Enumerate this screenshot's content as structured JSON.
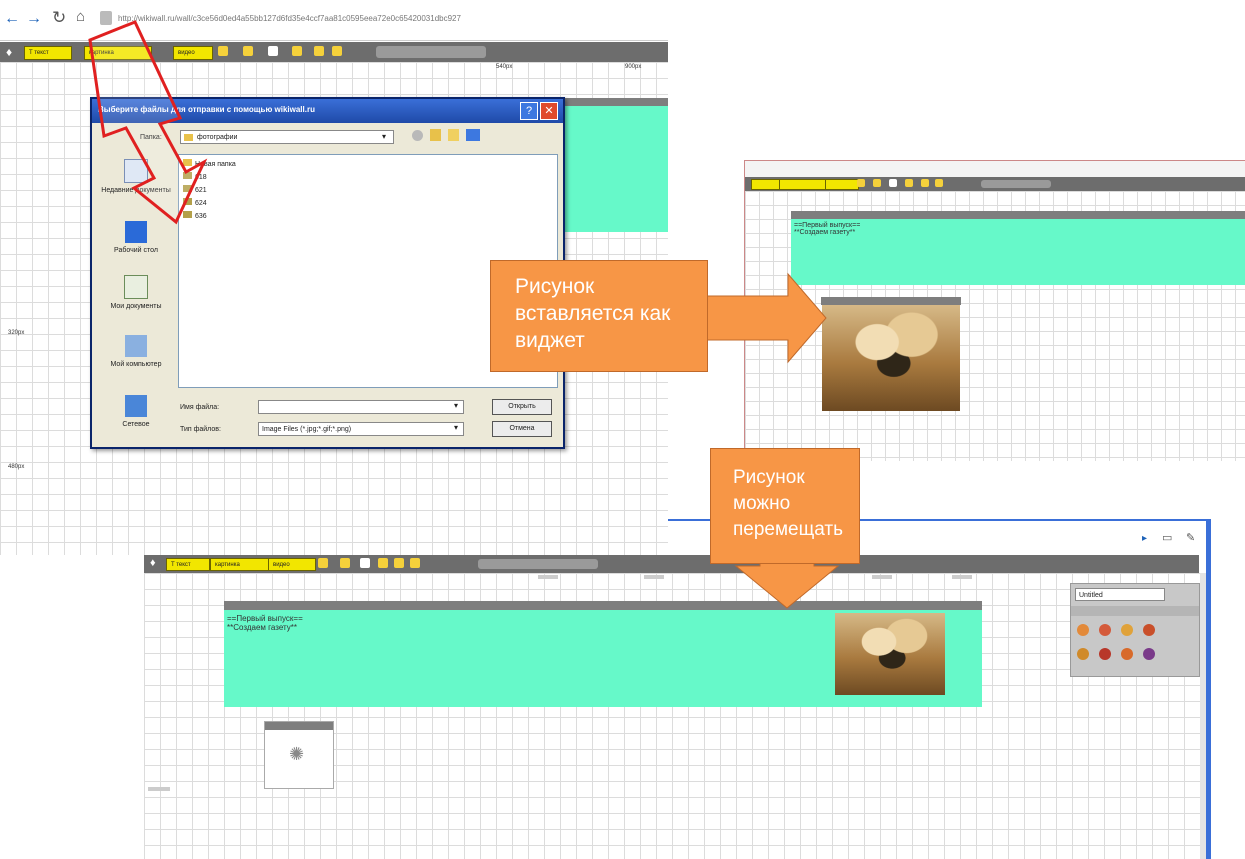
{
  "browser": {
    "url": "http://wikiwall.ru/wall/c3ce56d0ed4a55bb127d6fd35e4ccf7aa81c0595eea72e0c65420031dbc927"
  },
  "toolbar": {
    "text_btn": "T текст",
    "picture_btn": "картинка",
    "video_btn": "видео"
  },
  "ruler": {
    "top_1": "540px",
    "top_2": "900px",
    "left_1": "320px",
    "left_2": "480px"
  },
  "dialog": {
    "title": "Выберите файлы для отправки с помощью wikiwall.ru",
    "folder_label": "Папка:",
    "folder_value": "фотографии",
    "files": [
      "Новая папка",
      "618",
      "621",
      "624",
      "636"
    ],
    "sidebar": [
      "Недавние документы",
      "Рабочий стол",
      "Мои документы",
      "Мой компьютер",
      "Сетевое"
    ],
    "filename_label": "Имя файла:",
    "filename_value": "",
    "filetype_label": "Тип файлов:",
    "filetype_value": "Image Files (*.jpg;*.gif;*.png)",
    "open_btn": "Открыть",
    "cancel_btn": "Отмена"
  },
  "callouts": {
    "insert": "Рисунок вставляется как виджет",
    "move": "Рисунок можно перемещать"
  },
  "wall": {
    "line1": "==Первый выпуск==",
    "line2": "**Создаем газету**"
  },
  "right_panel": {
    "search_value": "Untitled"
  },
  "colors": {
    "callout": "#f79646",
    "widget_teal": "#66f9c9",
    "toolbar_gray": "#6d6d6d",
    "arrow_red": "#e02020",
    "dialog_blue": "#1f4aa8"
  }
}
